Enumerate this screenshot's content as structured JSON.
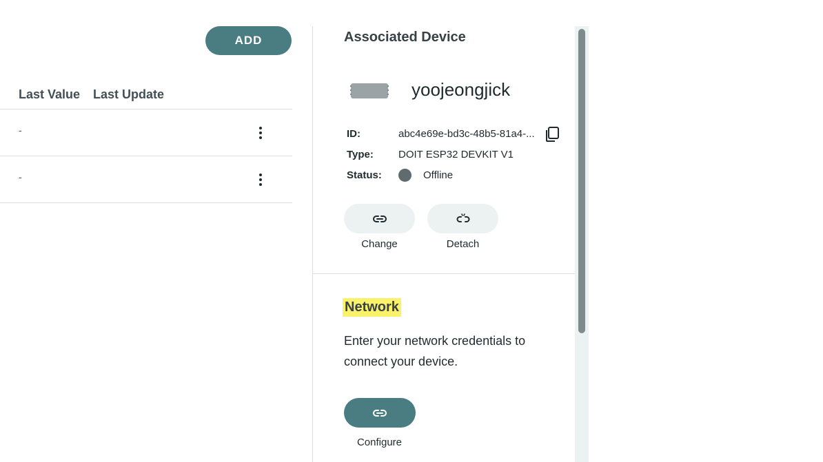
{
  "toolbar": {
    "add_label": "ADD"
  },
  "table": {
    "columns": [
      "Last Value",
      "Last Update"
    ],
    "rows": [
      {
        "last_value": "-",
        "last_update": ""
      },
      {
        "last_value": "-",
        "last_update": ""
      }
    ]
  },
  "device_panel": {
    "title": "Associated Device",
    "device_name": "yoojeongjick",
    "id_label": "ID:",
    "id_value": "abc4e69e-bd3c-48b5-81a4-...",
    "type_label": "Type:",
    "type_value": "DOIT ESP32 DEVKIT V1",
    "status_label": "Status:",
    "status_value": "Offline",
    "change_label": "Change",
    "detach_label": "Detach"
  },
  "network_panel": {
    "title": "Network",
    "description": "Enter your network credentials to connect your device.",
    "configure_label": "Configure"
  },
  "icons": {
    "copy": "copy-icon",
    "link": "link-icon",
    "unlink": "unlink-icon",
    "more": "more-vertical-icon",
    "device": "device-board-icon"
  },
  "colors": {
    "accent": "#4a7d82",
    "highlight": "#fbf26b",
    "status_offline": "#5f6b6f",
    "pill_bg": "#ecf1f1"
  }
}
